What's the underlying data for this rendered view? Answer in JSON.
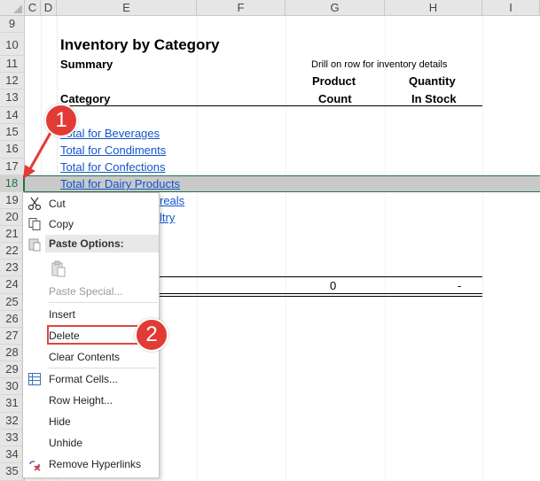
{
  "columns": [
    "C",
    "D",
    "E",
    "F",
    "G",
    "H",
    "I"
  ],
  "rows": [
    "9",
    "10",
    "11",
    "12",
    "13",
    "14",
    "15",
    "16",
    "17",
    "18",
    "19",
    "20",
    "21",
    "22",
    "23",
    "24",
    "25",
    "26",
    "27",
    "28",
    "29",
    "30",
    "31",
    "32",
    "33",
    "34",
    "35"
  ],
  "sheet": {
    "title": "Inventory by Category",
    "summary": "Summary",
    "drill_note": "Drill on row for inventory details",
    "header_product_1": "Product",
    "header_product_2": "Count",
    "header_quantity_1": "Quantity",
    "header_quantity_2": "In Stock",
    "category_header": "Category",
    "links": [
      "Total for Beverages",
      "Total for Condiments",
      "Total for Confections",
      "Total for Dairy Products",
      "reals",
      "ltry"
    ],
    "total_count": "0",
    "total_qty": "-"
  },
  "context_menu": {
    "cut": "Cut",
    "copy": "Copy",
    "paste_options": "Paste Options:",
    "paste_special": "Paste Special...",
    "insert": "Insert",
    "delete": "Delete",
    "clear_contents": "Clear Contents",
    "format_cells": "Format Cells...",
    "row_height": "Row Height...",
    "hide": "Hide",
    "unhide": "Unhide",
    "remove_hyperlinks": "Remove Hyperlinks"
  },
  "callouts": [
    "1",
    "2"
  ],
  "colors": {
    "selection": "#217346",
    "link": "#1155cc",
    "callout": "#e23b36"
  }
}
